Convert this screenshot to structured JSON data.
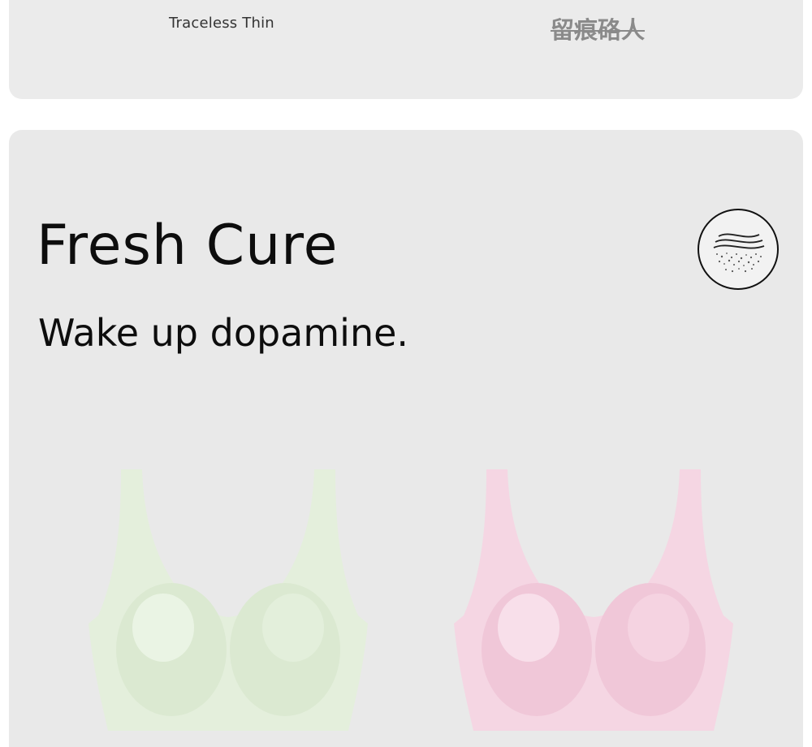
{
  "top_card": {
    "label_en": "Traceless Thin",
    "label_zh": "留痕硌人"
  },
  "feature": {
    "headline": "Fresh Cure",
    "subline": "Wake up dopamine.",
    "badge_icon": "breathable-fabric-icon"
  },
  "products": [
    {
      "name": "bra-mint-green",
      "color": "#e3eedb"
    },
    {
      "name": "bra-pink",
      "color": "#f4d4e2"
    }
  ]
}
